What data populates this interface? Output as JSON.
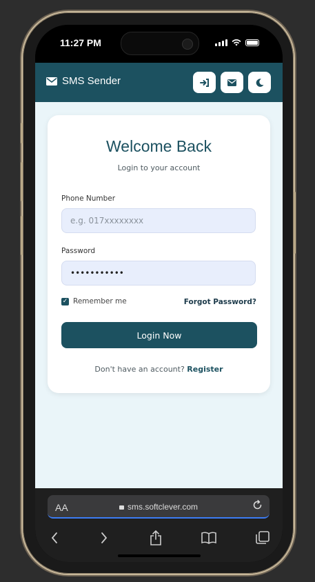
{
  "status": {
    "time": "11:27 PM"
  },
  "header": {
    "brand": "SMS Sender",
    "icons": [
      "sign-in-icon",
      "envelope-icon",
      "moon-icon"
    ]
  },
  "login": {
    "title": "Welcome Back",
    "subtitle": "Login to your account",
    "phone_label": "Phone Number",
    "phone_placeholder": "e.g. 017xxxxxxxx",
    "password_label": "Password",
    "password_value": "•••••••••••",
    "remember_label": "Remember me",
    "remember_checked": true,
    "forgot_label": "Forgot Password?",
    "login_button": "Login Now",
    "register_prompt": "Don't have an account?",
    "register_link": "Register"
  },
  "browser": {
    "aa_label": "AA",
    "url": "sms.softclever.com"
  },
  "colors": {
    "primary": "#1c5160",
    "page_bg": "#eaf5f9",
    "input_bg": "#e8eefc"
  }
}
